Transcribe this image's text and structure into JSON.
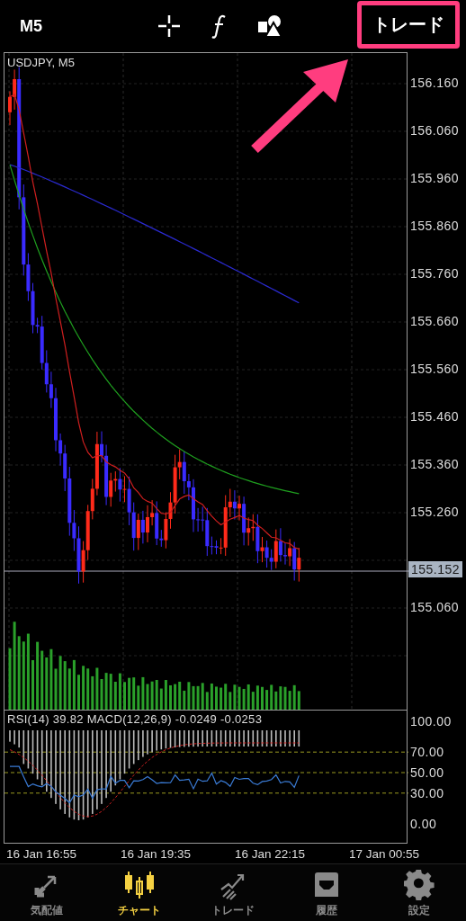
{
  "header": {
    "timeframe": "M5",
    "trade_button": "トレード"
  },
  "chart": {
    "symbol_label": "USDJPY, M5",
    "price_labels": [
      "156.160",
      "156.060",
      "155.960",
      "155.860",
      "155.760",
      "155.660",
      "155.560",
      "155.460",
      "155.360",
      "155.260",
      "155.060"
    ],
    "current_price": "155.152",
    "indicator_label": "RSI(14) 39.82 MACD(12,26,9) -0.0249 -0.0253",
    "indicator_labels": [
      "100.00",
      "70.00",
      "50.00",
      "30.00",
      "0.00"
    ],
    "time_labels": [
      "16 Jan 16:55",
      "16 Jan 19:35",
      "16 Jan 22:15",
      "17 Jan 00:55"
    ]
  },
  "tabs": [
    {
      "kind": "quotes",
      "label": "気配値",
      "selected": false
    },
    {
      "kind": "chart",
      "label": "チャート",
      "selected": true
    },
    {
      "kind": "trade",
      "label": "トレード",
      "selected": false
    },
    {
      "kind": "history",
      "label": "履歴",
      "selected": false
    },
    {
      "kind": "settings",
      "label": "設定",
      "selected": false
    }
  ]
}
